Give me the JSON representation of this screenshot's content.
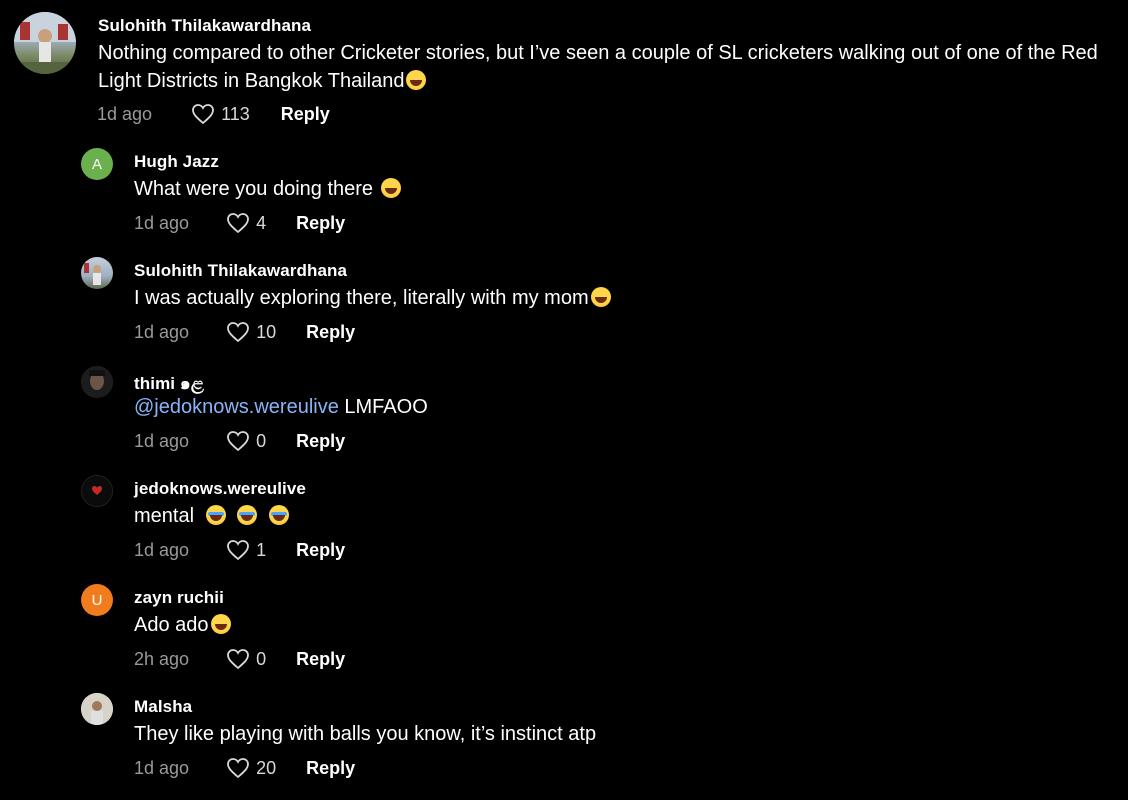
{
  "comments": [
    {
      "author": "Sulohith Thilakawardhana",
      "text": "Nothing compared to other Cricketer stories, but I’ve seen a couple of SL cricketers walking out of one of the Red Light Districts in Bangkok Thailand",
      "time": "1d ago",
      "likes": "113",
      "reply": "Reply"
    },
    {
      "author": "Hugh Jazz",
      "avatar_letter": "A",
      "text": "What were you doing there",
      "time": "1d ago",
      "likes": "4",
      "reply": "Reply"
    },
    {
      "author": "Sulohith Thilakawardhana",
      "text": "I was actually exploring there, literally with my mom",
      "time": "1d ago",
      "likes": "10",
      "reply": "Reply"
    },
    {
      "author": "thimi ๑ළ",
      "mention": "@jedoknows.wereulive",
      "text": " LMFAOO",
      "time": "1d ago",
      "likes": "0",
      "reply": "Reply"
    },
    {
      "author": "jedoknows.wereulive",
      "text": "mental",
      "time": "1d ago",
      "likes": "1",
      "reply": "Reply"
    },
    {
      "author": "zayn ruchii",
      "avatar_letter": "U",
      "text": "Ado ado",
      "time": "2h ago",
      "likes": "0",
      "reply": "Reply"
    },
    {
      "author": "Malsha",
      "text": "They like playing with balls you know, it’s instinct atp",
      "time": "1d ago",
      "likes": "20",
      "reply": "Reply"
    }
  ],
  "colors": {
    "background": "#000000",
    "mention": "#8ab4f8",
    "avatar_green": "#6ab04c",
    "avatar_orange": "#f07c1e",
    "muted_text": "#9a9a9a"
  },
  "icons": {
    "like": "heart-outline-icon",
    "emoji_laugh": "laughing-face-emoji",
    "emoji_cry": "crying-face-emoji"
  }
}
